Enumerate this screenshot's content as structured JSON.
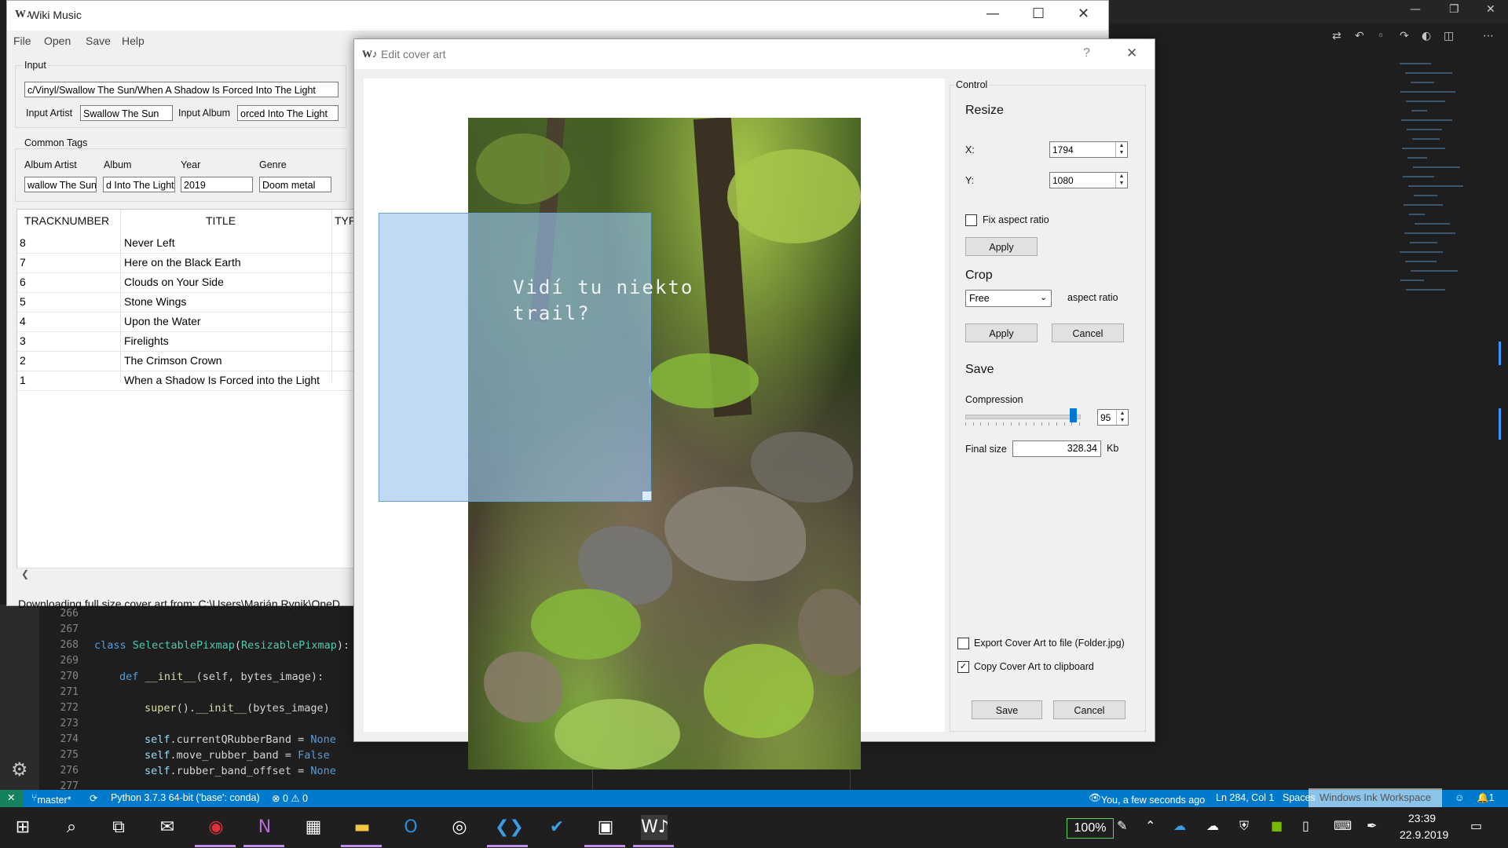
{
  "main_window": {
    "title": "Wiki Music",
    "logo": "W♪",
    "menu": [
      "File",
      "Open",
      "Save",
      "Help"
    ],
    "input_group": {
      "title": "Input",
      "path_value": "c/Vinyl/Swallow The Sun/When A Shadow Is Forced Into The Light",
      "artist_label": "Input Artist",
      "artist_value": "Swallow The Sun",
      "album_label": "Input Album",
      "album_value": "orced Into The Light"
    },
    "common_tags": {
      "title": "Common Tags",
      "labels": [
        "Album Artist",
        "Album",
        "Year",
        "Genre"
      ],
      "values": [
        "wallow The Sun",
        "d Into The Light",
        "2019",
        "Doom metal"
      ]
    },
    "table": {
      "headers": [
        "TRACKNUMBER",
        "TITLE",
        "TYPE"
      ],
      "rows": [
        {
          "num": "8",
          "title": "Never Left"
        },
        {
          "num": "7",
          "title": "Here on the Black Earth"
        },
        {
          "num": "6",
          "title": "Clouds on Your Side"
        },
        {
          "num": "5",
          "title": "Stone Wings"
        },
        {
          "num": "4",
          "title": "Upon the Water"
        },
        {
          "num": "3",
          "title": "Firelights"
        },
        {
          "num": "2",
          "title": "The Crimson Crown"
        },
        {
          "num": "1",
          "title": "When a Shadow Is Forced into the Light"
        }
      ]
    },
    "status": "Downloading full size cover art from: C:\\Users\\Marián Rynik\\OneD"
  },
  "dialog": {
    "title": "Edit cover art",
    "help": "?",
    "close": "✕",
    "photo_text": [
      "Vidí tu niekto",
      "trail?"
    ],
    "control_title": "Control",
    "resize": {
      "title": "Resize",
      "x_label": "X:",
      "x_value": "1794",
      "y_label": "Y:",
      "y_value": "1080",
      "fix_aspect_label": "Fix aspect ratio",
      "fix_aspect_checked": false,
      "apply_label": "Apply"
    },
    "crop": {
      "title": "Crop",
      "mode": "Free",
      "aspect_label": "aspect ratio",
      "apply_label": "Apply",
      "cancel_label": "Cancel"
    },
    "save": {
      "title": "Save",
      "compression_label": "Compression",
      "compression_value": "95",
      "compression_level": 0.95,
      "final_size_label": "Final size",
      "final_size_value": "328.34",
      "final_size_unit": "Kb",
      "export_label": "Export Cover Art to file (Folder.jpg)",
      "export_checked": false,
      "clipboard_label": "Copy Cover Art to clipboard",
      "clipboard_checked": true,
      "save_label": "Save",
      "cancel_label": "Cancel"
    }
  },
  "editor": {
    "line_numbers": [
      "266",
      "267",
      "268",
      "269",
      "270",
      "271",
      "272",
      "273",
      "274",
      "275",
      "276",
      "277"
    ],
    "lines": {
      "l268": [
        "class",
        "SelectablePixmap",
        "(",
        "ResizablePixmap",
        "):"
      ],
      "l270": [
        "def",
        "__init__",
        "(self, bytes_image):"
      ],
      "l272": [
        "super",
        "().",
        "__init__",
        "(bytes_image)"
      ],
      "l274": [
        "self",
        ".currentQRubberBand = ",
        "None"
      ],
      "l275": [
        "self",
        ".move_rubber_band = ",
        "False"
      ],
      "l276": [
        "self",
        ".rubber_band_offset = ",
        "None"
      ]
    }
  },
  "statusbar": {
    "branch": "master*",
    "python": "Python 3.7.3 64-bit ('base': conda)",
    "problems": "⊗ 0 ⚠ 0",
    "blame": "You, a few seconds ago",
    "position": "Ln 284, Col 1",
    "spaces": "Spaces",
    "watermark": "Windows Ink Workspace"
  },
  "taskbar": {
    "battery": "100%",
    "time": "23:39",
    "date": "22.9.2019"
  },
  "colors": {
    "vscode_status": "#007acc",
    "selection": "#99c4f0",
    "slider": "#0078d7"
  }
}
